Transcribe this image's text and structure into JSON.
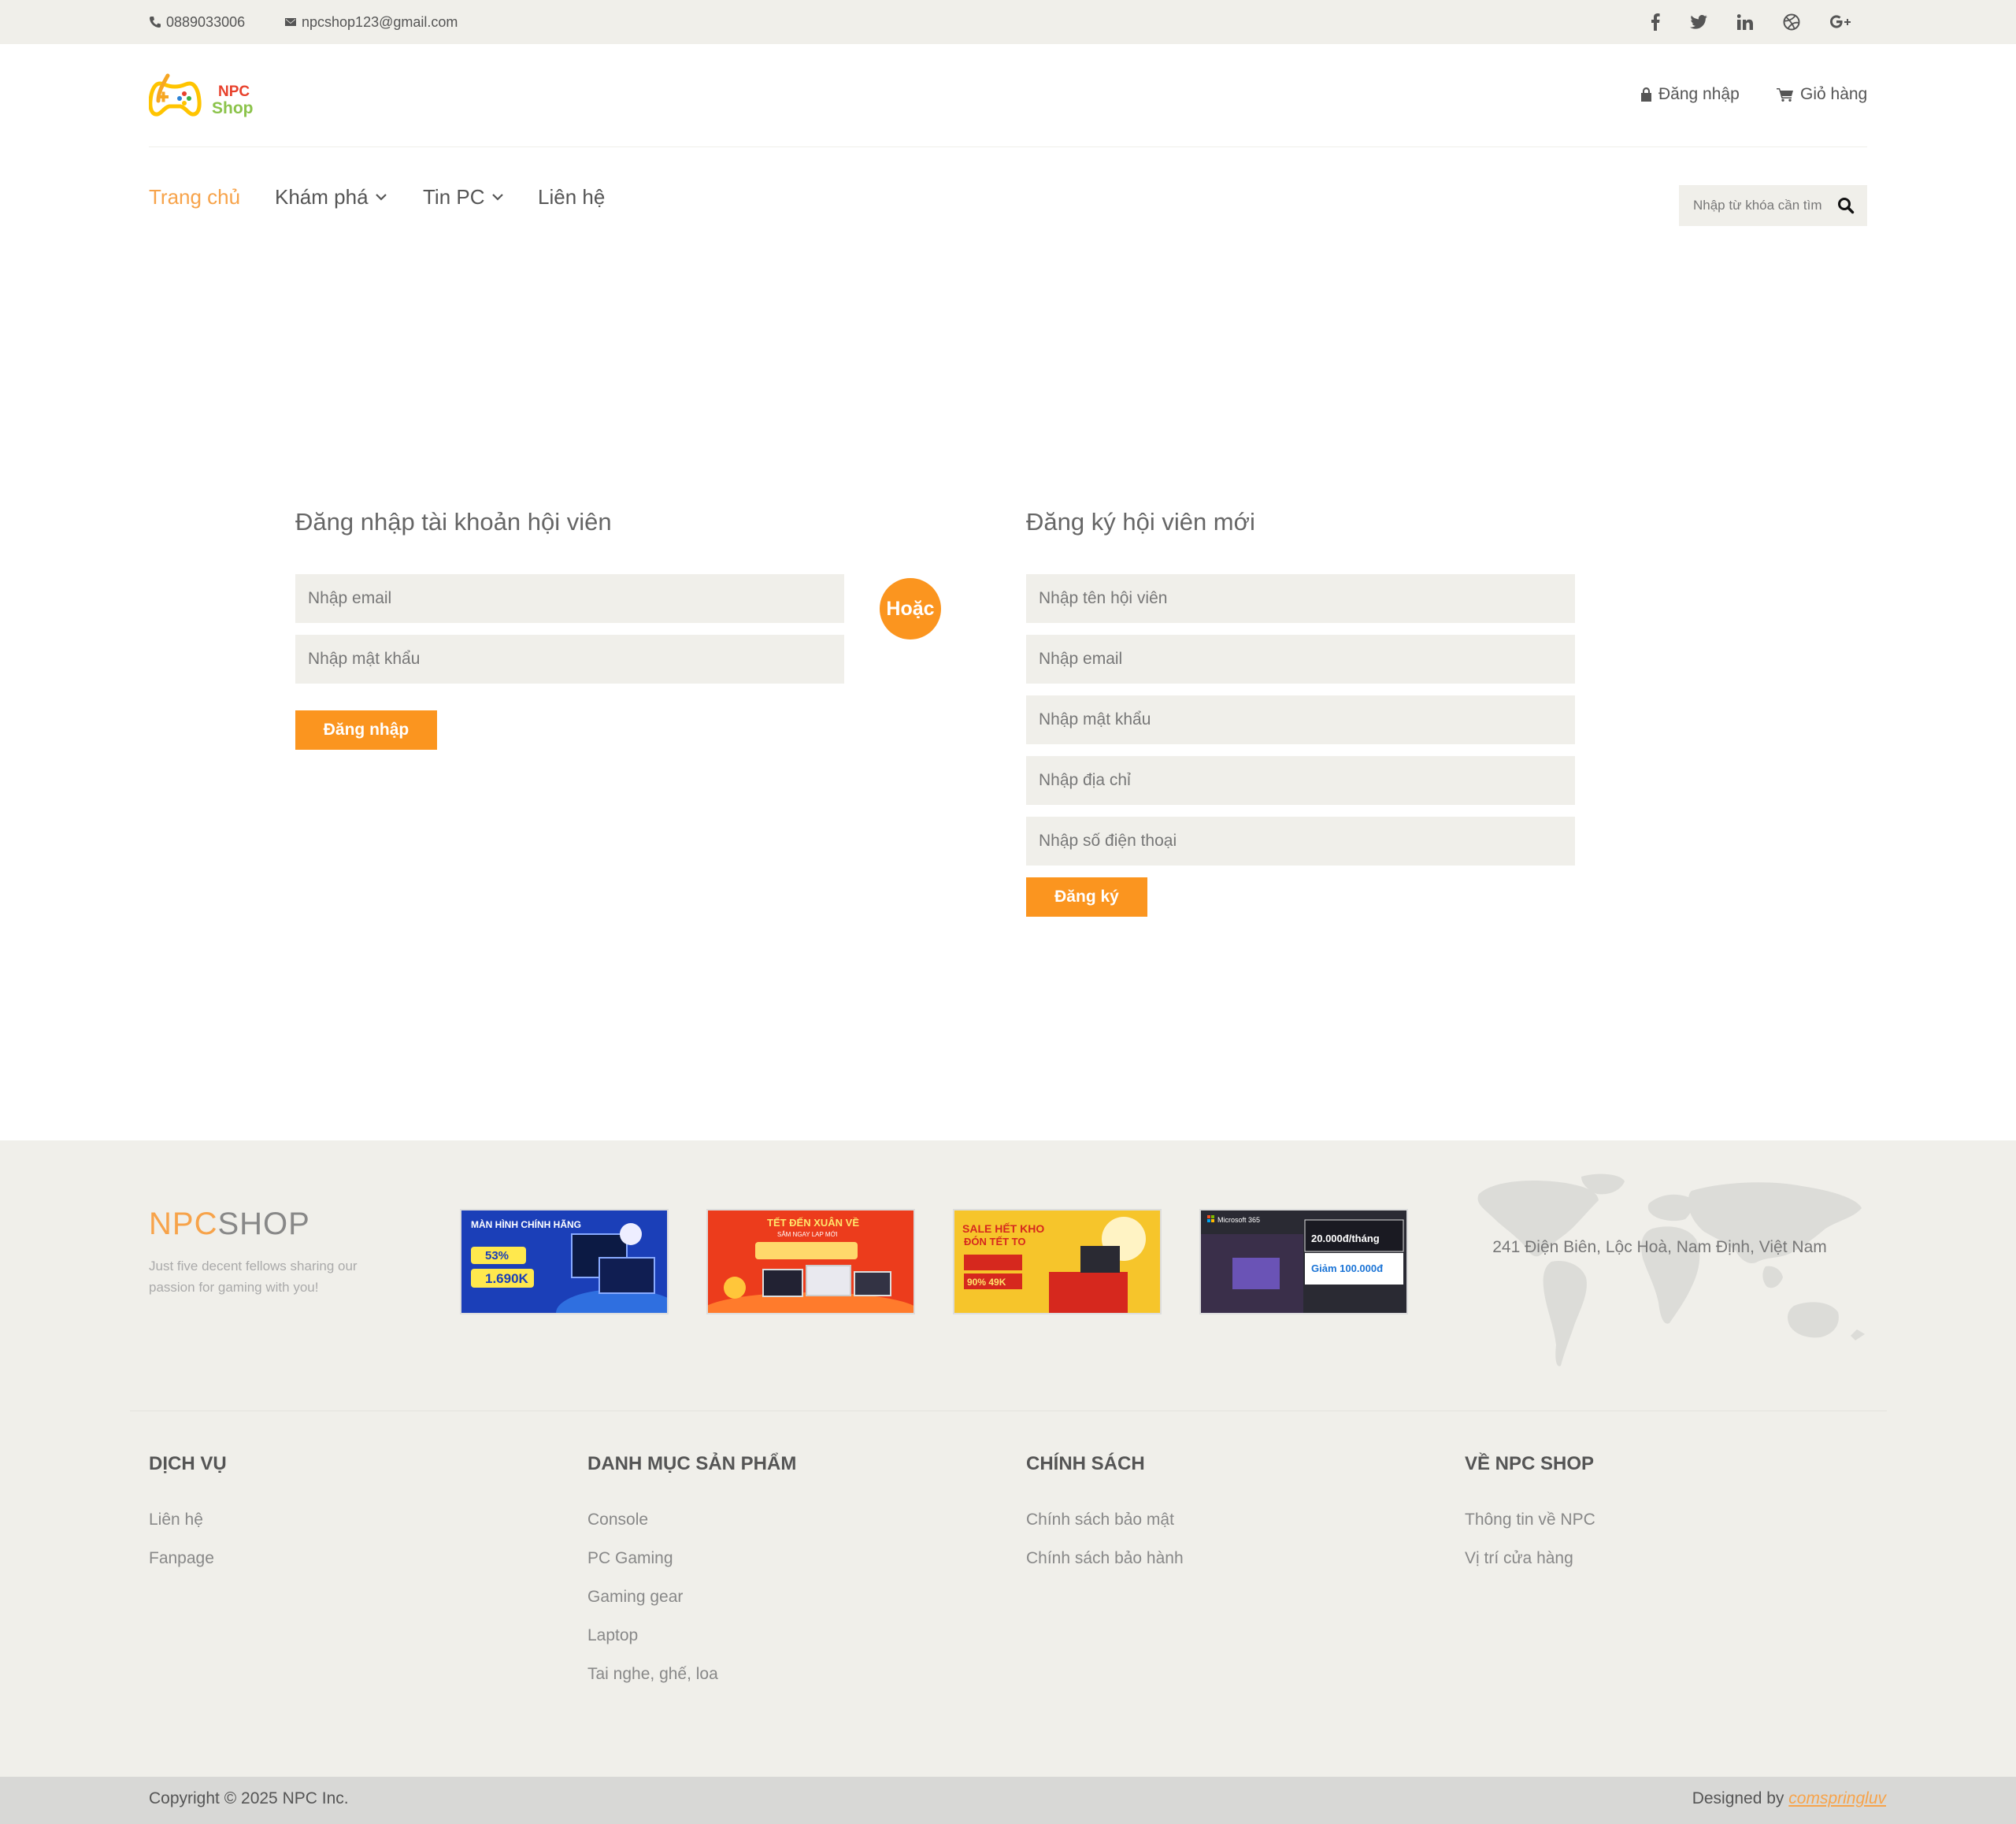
{
  "topbar": {
    "phone": "0889033006",
    "email": "npcshop123@gmail.com",
    "social_icons": [
      "facebook-icon",
      "twitter-icon",
      "linkedin-icon",
      "dribbble-icon",
      "google-plus-icon"
    ]
  },
  "header": {
    "logo_line1": "NPC",
    "logo_line2": "Shop",
    "login_link": "Đăng nhập",
    "cart_link": "Giỏ hàng"
  },
  "nav": {
    "home": "Trang chủ",
    "explore": "Khám phá",
    "news": "Tin PC",
    "contact": "Liên hệ"
  },
  "search": {
    "placeholder": "Nhập từ khóa cần tìm"
  },
  "login_form": {
    "title": "Đăng nhập tài khoản hội viên",
    "email_placeholder": "Nhập email",
    "password_placeholder": "Nhập mật khẩu",
    "submit": "Đăng nhập"
  },
  "divider_label": "Hoặc",
  "register_form": {
    "title": "Đăng ký hội viên mới",
    "name_placeholder": "Nhập tên hội viên",
    "email_placeholder": "Nhập email",
    "password_placeholder": "Nhập mật khẩu",
    "address_placeholder": "Nhập địa chỉ",
    "phone_placeholder": "Nhập số điện thoại",
    "submit": "Đăng ký"
  },
  "footer": {
    "brand_part1": "NPC",
    "brand_part2": "SHOP",
    "tagline": "Just five decent fellows sharing our passion for gaming with you!",
    "promos": [
      {
        "line1": "MÀN HÌNH CHÍNH HÃNG",
        "line2": "53%",
        "line3": "1.690K",
        "bg": "#1b3fb8"
      },
      {
        "line1": "TẾT ĐẾN XUÂN VỀ",
        "line2": "SẮM NGAY LAP MỚI",
        "line3": "",
        "bg": "#ec3c1c"
      },
      {
        "line1": "SALE HẾT KHO",
        "line2": "ĐÓN TẾT TO",
        "line3": "90%  49K",
        "bg": "#f6c52b"
      },
      {
        "line1": "Microsoft 365",
        "line2": "20.000đ/tháng",
        "line3": "Giảm 100.000đ",
        "bg": "#2a2a33"
      }
    ],
    "address": "241 Điện Biên, Lộc Hoà, Nam Định, Việt Nam",
    "columns": [
      {
        "title": "DỊCH VỤ",
        "links": [
          "Liên hệ",
          "Fanpage"
        ]
      },
      {
        "title": "DANH MỤC SẢN PHẨM",
        "links": [
          "Console",
          "PC Gaming",
          "Gaming gear",
          "Laptop",
          "Tai nghe, ghế, loa"
        ]
      },
      {
        "title": "CHÍNH SÁCH",
        "links": [
          "Chính sách bảo mật",
          "Chính sách bảo hành"
        ]
      },
      {
        "title": "VỀ NPC SHOP",
        "links": [
          "Thông tin về NPC",
          "Vị trí cửa hàng"
        ]
      }
    ],
    "copyright": "Copyright © 2025 NPC Inc.",
    "designed_by": "Designed by",
    "designer": "comspringluv"
  },
  "colors": {
    "accent": "#fb951f",
    "accent_light": "#f7a34a",
    "panel": "#f0efea"
  }
}
